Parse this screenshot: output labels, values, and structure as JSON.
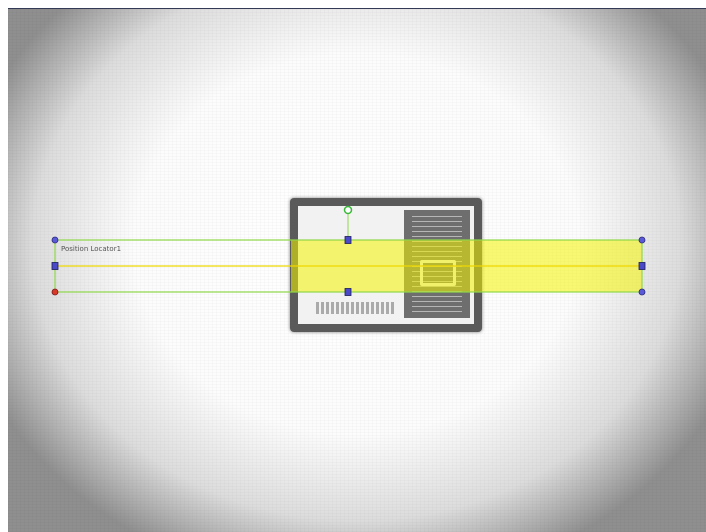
{
  "tool": {
    "name": "Position Locator1"
  },
  "colors": {
    "region_border": "#8fd84a",
    "region_fill": "#f4f400",
    "center_line": "#f0d800",
    "handle_blue": "#4a4ac8",
    "handle_red": "#d83a2a",
    "handle_green": "#3ab83a"
  },
  "icons": {
    "rotation_handle": "green-circle",
    "origin_handle": "red-circle",
    "corner_handle": "blue-circle",
    "edge_handle": "blue-square"
  }
}
